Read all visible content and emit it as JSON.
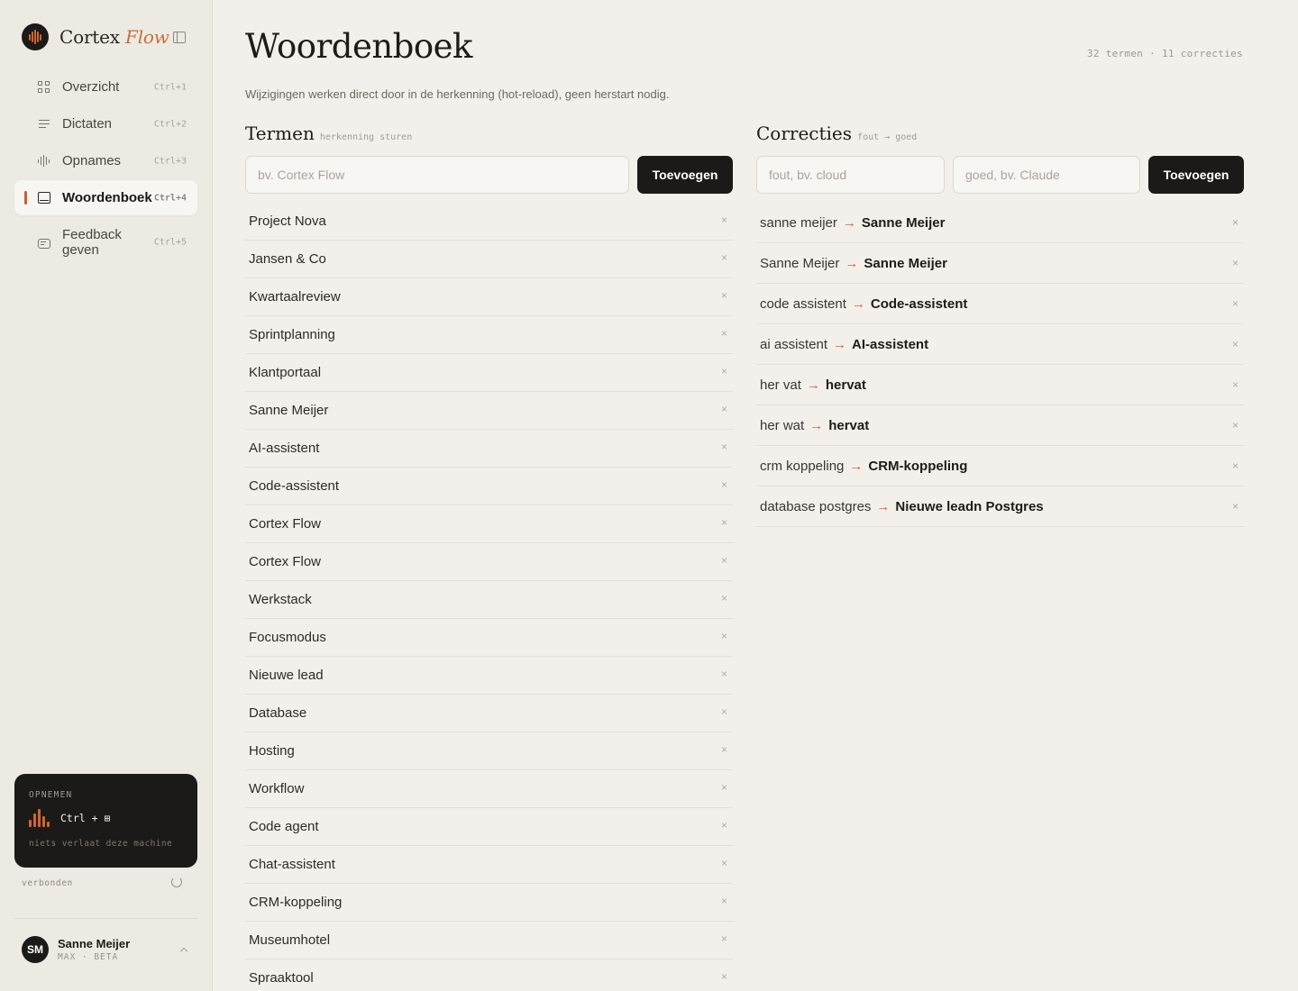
{
  "app": {
    "brand_primary": "Cortex",
    "brand_secondary": "Flow",
    "accent_color": "#d0652e",
    "dark_color": "#1c1a18"
  },
  "sidebar": {
    "nav": [
      {
        "label": "Overzicht",
        "shortcut": "Ctrl+1",
        "icon": "grid-icon"
      },
      {
        "label": "Dictaten",
        "shortcut": "Ctrl+2",
        "icon": "lines-icon"
      },
      {
        "label": "Opnames",
        "shortcut": "Ctrl+3",
        "icon": "waveform-icon"
      },
      {
        "label": "Woordenboek",
        "shortcut": "Ctrl+4",
        "icon": "book-icon",
        "active": true
      },
      {
        "label": "Feedback geven",
        "shortcut": "Ctrl+5",
        "icon": "chat-icon"
      }
    ],
    "record": {
      "title": "OPNEMEN",
      "shortcut": "Ctrl + ⊞",
      "note": "niets verlaat deze machine"
    },
    "status": "verbonden",
    "user": {
      "initials": "SM",
      "name": "Sanne Meijer",
      "plan": "MAX · BETA"
    }
  },
  "page": {
    "title": "Woordenboek",
    "stats": "32 termen · 11 correcties",
    "subtitle": "Wijzigingen werken direct door in de herkenning (hot-reload), geen herstart nodig."
  },
  "terms": {
    "title": "Termen",
    "hint": "herkenning sturen",
    "input_placeholder": "bv. Cortex Flow",
    "add_label": "Toevoegen",
    "items": [
      "Project Nova",
      "Jansen & Co",
      "Kwartaalreview",
      "Sprintplanning",
      "Klantportaal",
      "Sanne Meijer",
      "AI-assistent",
      "Code-assistent",
      "Cortex Flow",
      "Cortex Flow",
      "Werkstack",
      "Focusmodus",
      "Nieuwe lead",
      "Database",
      "Hosting",
      "Workflow",
      "Code agent",
      "Chat-assistent",
      "CRM-koppeling",
      "Museumhotel",
      "Spraaktool"
    ],
    "remove_glyph": "×"
  },
  "corrections": {
    "title": "Correcties",
    "hint": "fout → goed",
    "wrong_placeholder": "fout, bv. cloud",
    "right_placeholder": "goed, bv. Claude",
    "add_label": "Toevoegen",
    "arrow": "→",
    "items": [
      {
        "from": "sanne meijer",
        "to": "Sanne Meijer"
      },
      {
        "from": "Sanne Meijer",
        "to": "Sanne Meijer"
      },
      {
        "from": "code assistent",
        "to": "Code-assistent"
      },
      {
        "from": "ai assistent",
        "to": "AI-assistent"
      },
      {
        "from": "her vat",
        "to": "hervat"
      },
      {
        "from": "her wat",
        "to": "hervat"
      },
      {
        "from": "crm koppeling",
        "to": "CRM-koppeling"
      },
      {
        "from": "database postgres",
        "to": "Nieuwe leadn Postgres"
      }
    ]
  }
}
